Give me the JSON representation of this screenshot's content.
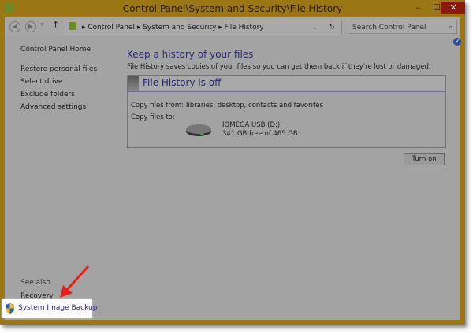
{
  "window": {
    "title": "Control Panel\\System and Security\\File History",
    "minimize": "–",
    "maximize": "☐",
    "close": "✕"
  },
  "nav": {
    "breadcrumb": [
      "Control Panel",
      "System and Security",
      "File History"
    ],
    "search_placeholder": "Search Control Panel"
  },
  "sidebar": {
    "home": "Control Panel Home",
    "items": [
      "Restore personal files",
      "Select drive",
      "Exclude folders",
      "Advanced settings"
    ],
    "see_also": "See also",
    "see_also_items": [
      "Recovery",
      "System Image Backup"
    ]
  },
  "main": {
    "heading": "Keep a history of your files",
    "description": "File History saves copies of your files so you can get them back if they're lost or damaged.",
    "status": "File History is off",
    "copy_from_label": "Copy files from:",
    "copy_from_value": "libraries, desktop, contacts and favorites",
    "copy_to_label": "Copy files to:",
    "drive_name": "IOMEGA USB (D:)",
    "drive_space": "341 GB free of 465 GB",
    "turn_on": "Turn on"
  },
  "colors": {
    "frame": "#9a7614",
    "close": "#8b1a0c",
    "heading": "#2b2a6e",
    "arrow": "#e8201a"
  }
}
